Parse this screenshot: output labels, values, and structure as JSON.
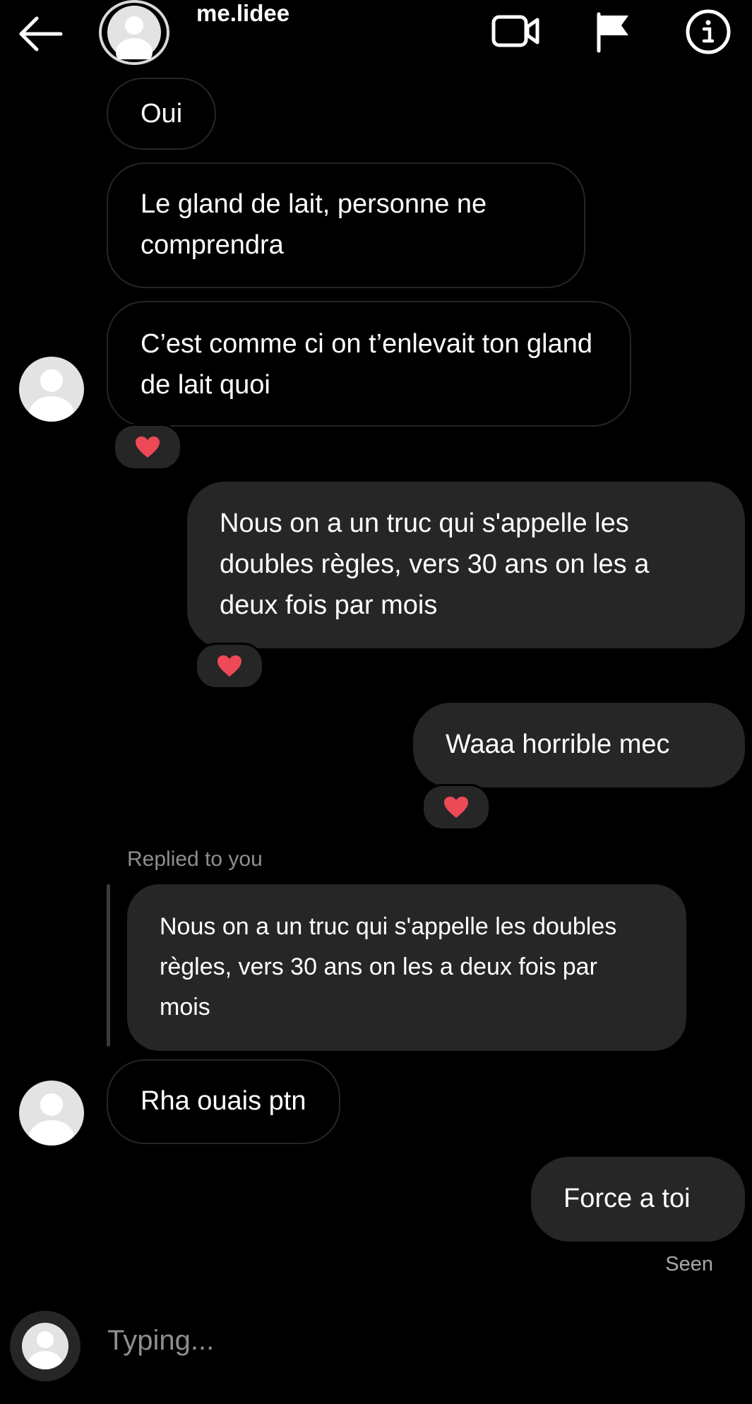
{
  "header": {
    "username": "me.lidee",
    "icons": [
      "back-arrow-icon",
      "video-call-icon",
      "flag-icon",
      "info-icon"
    ]
  },
  "messages": {
    "m1": "Oui",
    "m2": "Le gland de lait, personne ne comprendra",
    "m3": "C’est comme ci on t’enlevait ton gland de lait quoi",
    "m4": "Nous on a un truc qui s'appelle les doubles règles, vers 30 ans on les a deux fois par mois",
    "m5": "Waaa horrible mec",
    "reply_label": "Replied to you",
    "reply_quote": "Nous on a un truc qui s'appelle les doubles règles, vers 30 ans on les a deux fois par mois",
    "m6": "Rha ouais ptn",
    "m7": "Force a toi"
  },
  "status": {
    "seen": "Seen",
    "typing": "Typing..."
  },
  "colors": {
    "background": "#000000",
    "bubble_out": "#262626",
    "bubble_in_border": "#262626",
    "heart": "#ed4956",
    "muted_text": "#8e8e8e"
  }
}
